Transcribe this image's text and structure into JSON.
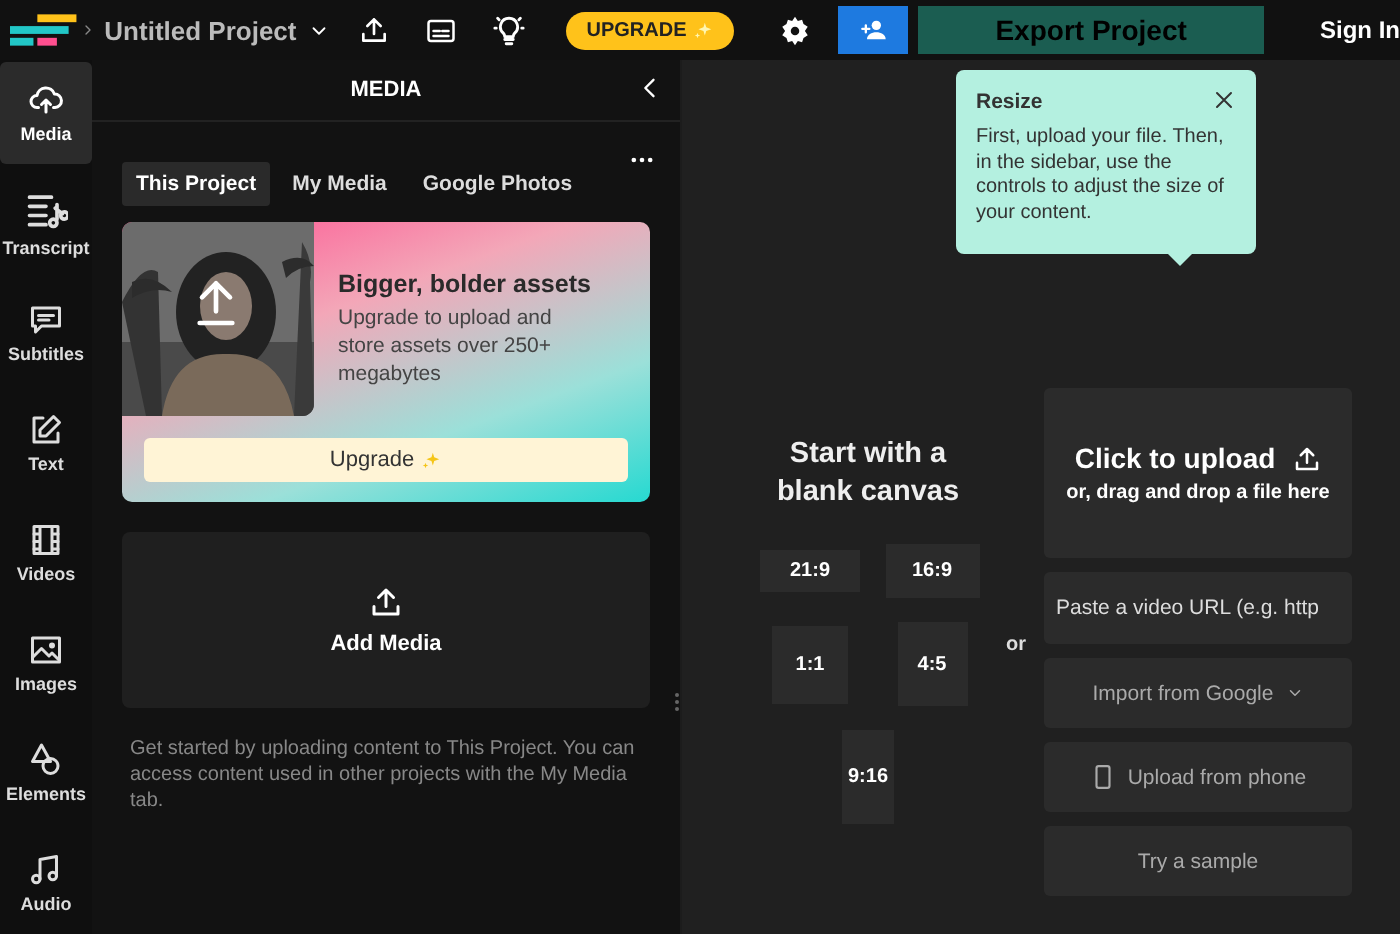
{
  "top_bar": {
    "project_title": "Untitled Project",
    "upgrade": "UPGRADE",
    "export": {
      "label": "Export Project",
      "disabled": true
    },
    "sign_in": "Sign In"
  },
  "nav": [
    {
      "label": "Media",
      "selected": true
    },
    {
      "label": "Transcript",
      "selected": false
    },
    {
      "label": "Subtitles",
      "selected": false
    },
    {
      "label": "Text",
      "selected": false
    },
    {
      "label": "Videos",
      "selected": false
    },
    {
      "label": "Images",
      "selected": false
    },
    {
      "label": "Elements",
      "selected": false
    },
    {
      "label": "Audio",
      "selected": false
    }
  ],
  "panel": {
    "title": "MEDIA",
    "tabs": [
      {
        "label": "This Project",
        "selected": true
      },
      {
        "label": "My Media",
        "selected": false
      },
      {
        "label": "Google Photos",
        "selected": false
      }
    ],
    "promo": {
      "title": "Bigger, bolder assets",
      "body": "Upgrade to upload and store assets over 250+ megabytes",
      "button": "Upgrade"
    },
    "add_media": "Add Media",
    "help": "Get started by uploading content to This Project. You can access content used in other projects with the My Media tab."
  },
  "canvas": {
    "heading": "Start with a blank canvas",
    "ratios": [
      "21:9",
      "16:9",
      "1:1",
      "4:5",
      "9:16"
    ],
    "or": "or",
    "upload": {
      "title": "Click to upload",
      "subtitle": "or, drag and drop a file here"
    },
    "url_field": {
      "placeholder": "Paste a video URL (e.g. http"
    },
    "import": "Import from Google",
    "phone": "Upload from phone",
    "sample": "Try a sample",
    "tooltip": {
      "title": "Resize",
      "body": "First, upload your file. Then, in the sidebar, use the controls to adjust the size of your content."
    }
  }
}
